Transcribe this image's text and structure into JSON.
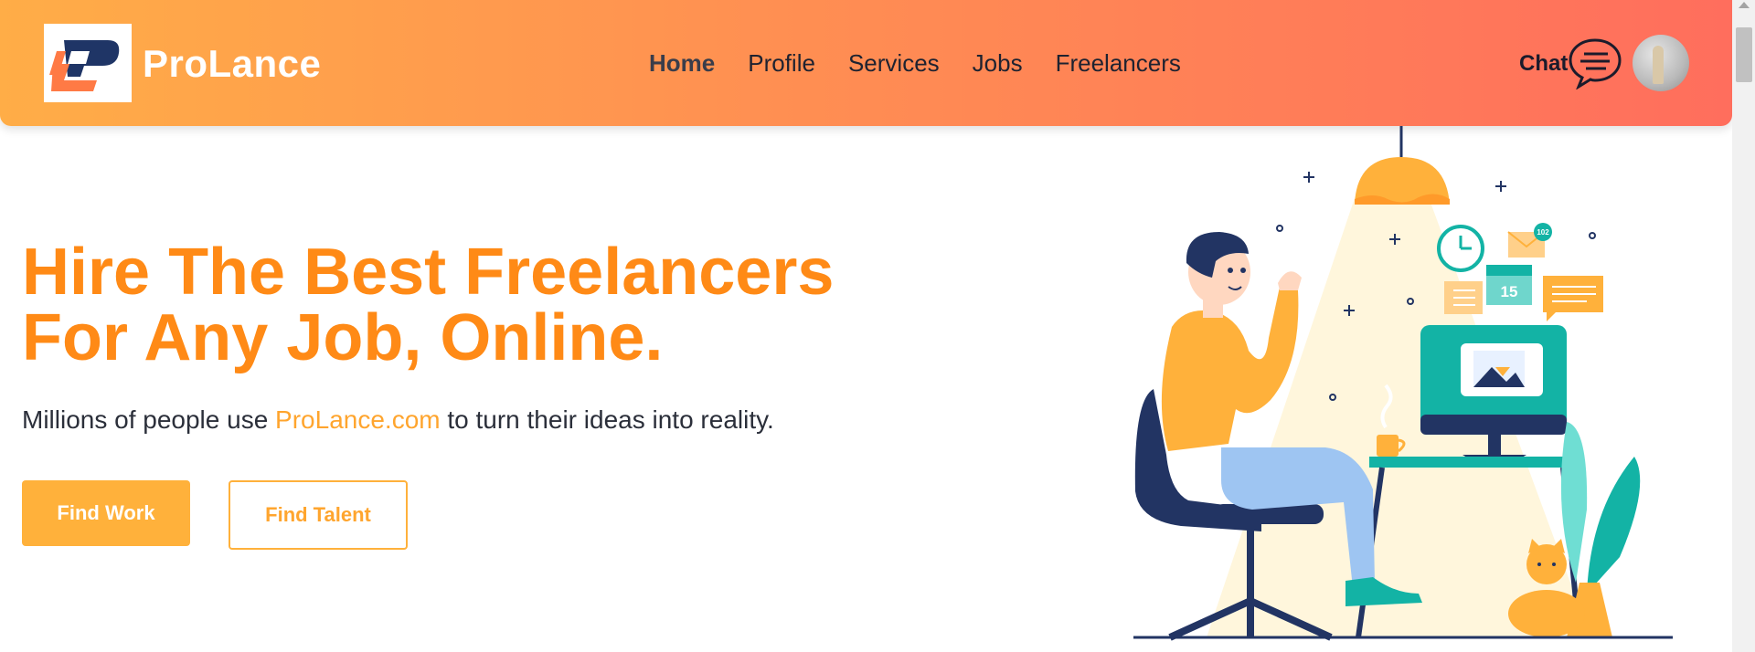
{
  "brand": {
    "name": "ProLance",
    "logo_icon": "prolance-logo-icon"
  },
  "nav": {
    "links": [
      {
        "label": "Home",
        "active": true
      },
      {
        "label": "Profile",
        "active": false
      },
      {
        "label": "Services",
        "active": false
      },
      {
        "label": "Jobs",
        "active": false
      },
      {
        "label": "Freelancers",
        "active": false
      }
    ],
    "chat_label": "Chat",
    "chat_icon": "chat-bubble-icon",
    "avatar": "user-avatar"
  },
  "hero": {
    "title_line1": "Hire The Best Freelancers",
    "title_line2": "For Any Job, Online.",
    "subtitle_prefix": "Millions of people use ",
    "subtitle_brand": "ProLance.com",
    "subtitle_suffix": " to turn their ideas into reality.",
    "find_work_label": "Find Work",
    "find_talent_label": "Find Talent"
  },
  "illustration": {
    "notification_count": "102",
    "calendar_day": "15"
  },
  "colors": {
    "accent_orange": "#ff8a16",
    "button_orange": "#ffb13b",
    "nav_gradient_start": "#ffad47",
    "nav_gradient_end": "#ff6e5d",
    "teal": "#13b3a5",
    "navy": "#223463"
  }
}
